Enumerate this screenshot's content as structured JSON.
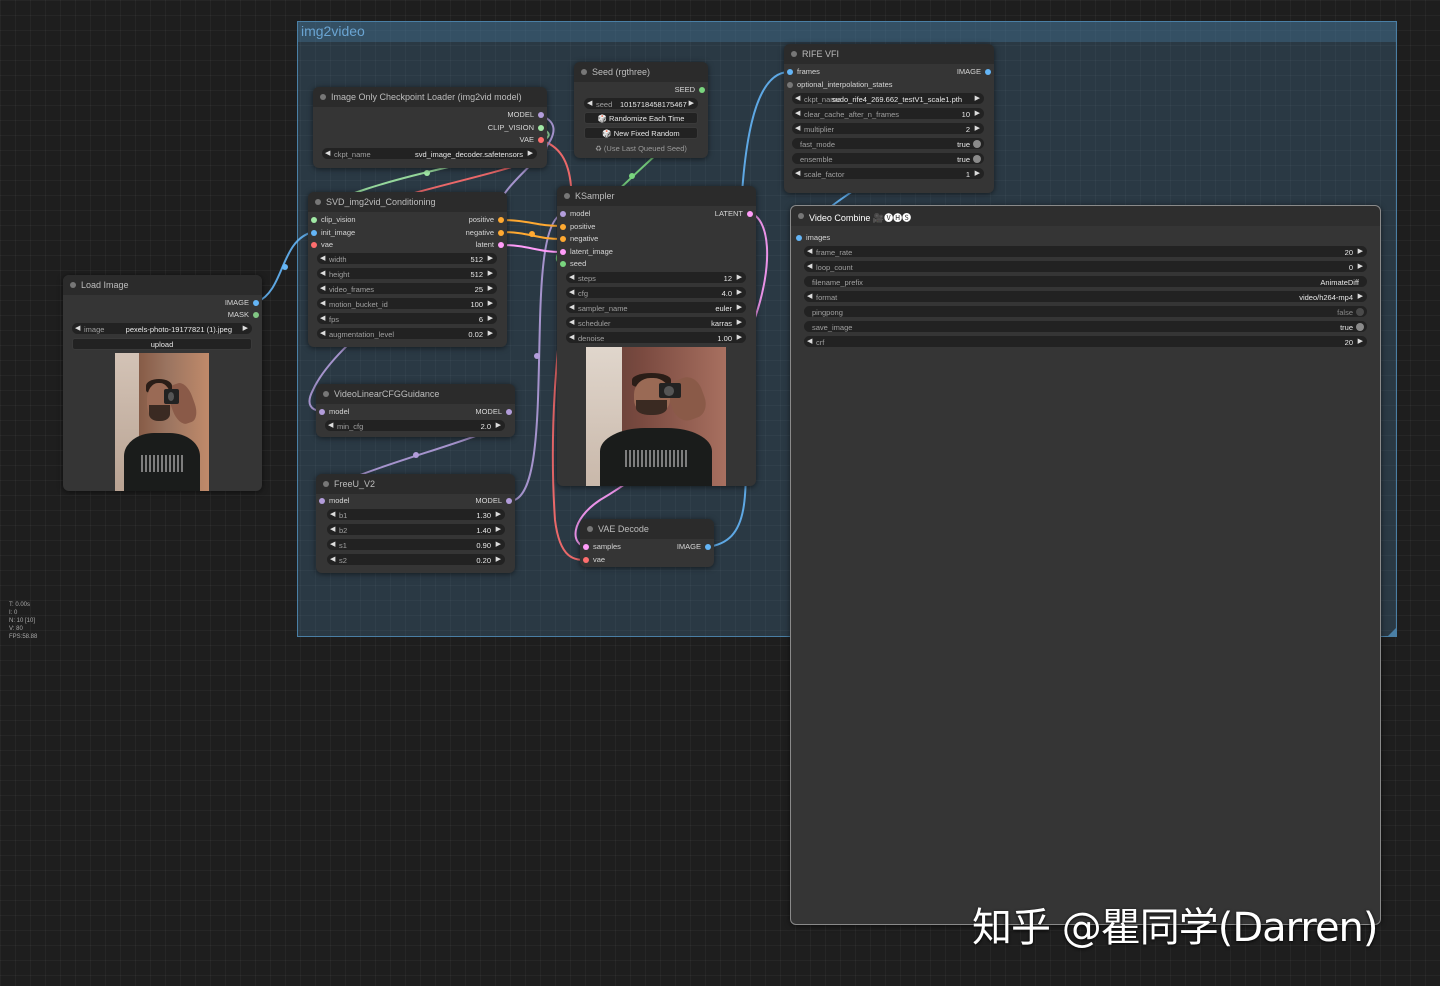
{
  "group": {
    "title": "img2video"
  },
  "nodes": {
    "load_image": {
      "title": "Load Image",
      "outputs": [
        "IMAGE",
        "MASK"
      ],
      "image_label": "image",
      "image_value": "pexels-photo-19177821 (1).jpeg",
      "upload_label": "upload"
    },
    "checkpoint": {
      "title": "Image Only Checkpoint Loader (img2vid model)",
      "outputs": [
        "MODEL",
        "CLIP_VISION",
        "VAE"
      ],
      "ckpt_label": "ckpt_name",
      "ckpt_value": "svd_image_decoder.safetensors"
    },
    "seed": {
      "title": "Seed (rgthree)",
      "output": "SEED",
      "seed_label": "seed",
      "seed_value": "1015718458175467",
      "btn_randomize": "🎲 Randomize Each Time",
      "btn_new_fixed": "🎲 New Fixed Random",
      "note": "♻ (Use Last Queued Seed)"
    },
    "svd": {
      "title": "SVD_img2vid_Conditioning",
      "inputs": [
        "clip_vision",
        "init_image",
        "vae"
      ],
      "outputs": [
        "positive",
        "negative",
        "latent"
      ],
      "widgets": [
        {
          "label": "width",
          "value": "512"
        },
        {
          "label": "height",
          "value": "512"
        },
        {
          "label": "video_frames",
          "value": "25"
        },
        {
          "label": "motion_bucket_id",
          "value": "100"
        },
        {
          "label": "fps",
          "value": "6"
        },
        {
          "label": "augmentation_level",
          "value": "0.02"
        }
      ]
    },
    "ksampler": {
      "title": "KSampler",
      "inputs": [
        "model",
        "positive",
        "negative",
        "latent_image",
        "seed"
      ],
      "output": "LATENT",
      "widgets": [
        {
          "label": "steps",
          "value": "12"
        },
        {
          "label": "cfg",
          "value": "4.0"
        },
        {
          "label": "sampler_name",
          "value": "euler"
        },
        {
          "label": "scheduler",
          "value": "karras"
        },
        {
          "label": "denoise",
          "value": "1.00"
        }
      ]
    },
    "rife": {
      "title": "RIFE VFI",
      "inputs": [
        "frames",
        "optional_interpolation_states"
      ],
      "output": "IMAGE",
      "widgets": [
        {
          "label": "ckpt_name",
          "value": "sudo_rife4_269.662_testV1_scale1.pth",
          "type": "combo"
        },
        {
          "label": "clear_cache_after_n_frames",
          "value": "10",
          "type": "number"
        },
        {
          "label": "multiplier",
          "value": "2",
          "type": "number"
        },
        {
          "label": "fast_mode",
          "value": "true",
          "type": "toggle"
        },
        {
          "label": "ensemble",
          "value": "true",
          "type": "toggle"
        },
        {
          "label": "scale_factor",
          "value": "1",
          "type": "number"
        }
      ]
    },
    "vcfg": {
      "title": "VideoLinearCFGGuidance",
      "input": "model",
      "output": "MODEL",
      "widget": {
        "label": "min_cfg",
        "value": "2.0"
      }
    },
    "freeu": {
      "title": "FreeU_V2",
      "input": "model",
      "output": "MODEL",
      "widgets": [
        {
          "label": "b1",
          "value": "1.30"
        },
        {
          "label": "b2",
          "value": "1.40"
        },
        {
          "label": "s1",
          "value": "0.90"
        },
        {
          "label": "s2",
          "value": "0.20"
        }
      ]
    },
    "vae_decode": {
      "title": "VAE Decode",
      "inputs": [
        "samples",
        "vae"
      ],
      "output": "IMAGE"
    },
    "video_combine": {
      "title": "Video Combine 🎥🅥🅗🅢",
      "input": "images",
      "widgets": [
        {
          "label": "frame_rate",
          "value": "20",
          "type": "number"
        },
        {
          "label": "loop_count",
          "value": "0",
          "type": "number"
        },
        {
          "label": "filename_prefix",
          "value": "AnimateDiff",
          "type": "text"
        },
        {
          "label": "format",
          "value": "video/h264-mp4",
          "type": "combo"
        },
        {
          "label": "pingpong",
          "value": "false",
          "type": "toggle"
        },
        {
          "label": "save_image",
          "value": "true",
          "type": "toggle"
        },
        {
          "label": "crf",
          "value": "20",
          "type": "number"
        }
      ]
    }
  },
  "stats": [
    "T: 0.00s",
    "I: 0",
    "N: 10 [10]",
    "V: 80",
    "FPS:58.88"
  ],
  "watermark": "知乎 @瞿同学(Darren)",
  "colors": {
    "model": "#b39ddb",
    "clip_vision": "#a1e9a5",
    "vae": "#ff6e6e",
    "conditioning": "#ffa931",
    "latent": "#ff9cf9",
    "image": "#64b5f6",
    "mask": "#81c784",
    "int": "#79d57e",
    "group": "#4a7fa5"
  },
  "icons": {
    "left_arrow": "left-arrow-icon",
    "right_arrow": "right-arrow-icon",
    "dice": "dice-icon",
    "recycle": "recycle-icon"
  }
}
